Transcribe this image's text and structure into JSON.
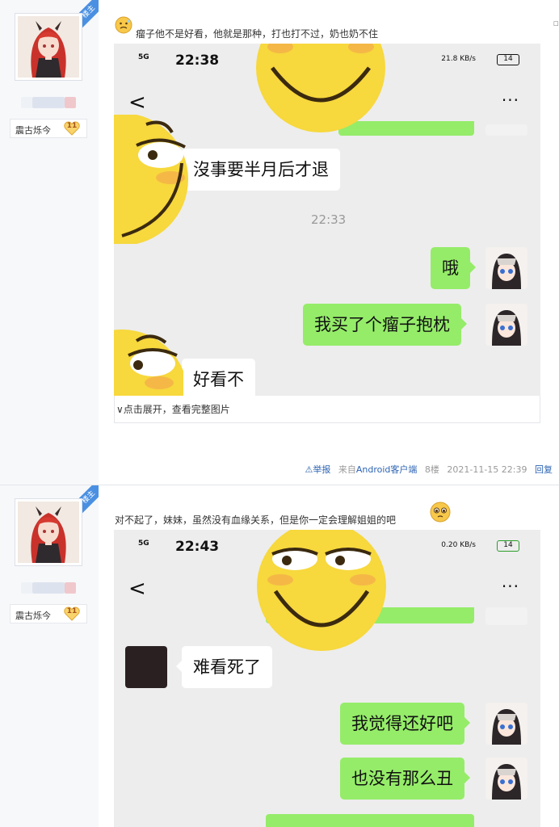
{
  "post1": {
    "corner_badge": "楼主",
    "level_name": "震古烁今",
    "level_num": "11",
    "text": "瘤子他不是好看，他就是那种，打也打不过，奶也奶不住",
    "shot": {
      "signal": "5G",
      "time": "22:38",
      "net_speed": "21.8 KB/s",
      "battery": "14",
      "back": "<",
      "more": "···",
      "bubble_other_1": "沒事要半月后才退",
      "timestamp": "22:33",
      "bubble_me_1": "哦",
      "bubble_me_2": "我买了个瘤子抱枕",
      "bubble_other_2": "好看不"
    },
    "expand_text": "点击展开，查看完整图片",
    "footer": {
      "report": "举报",
      "from_prefix": "来自",
      "client": "Android客户端",
      "floor": "8楼",
      "datetime": "2021-11-15 22:39",
      "reply": "回复"
    }
  },
  "post2": {
    "corner_badge": "楼主",
    "level_name": "震古烁今",
    "level_num": "11",
    "text": "对不起了，妹妹，虽然没有血缘关系，但是你一定会理解姐姐的吧",
    "shot": {
      "signal": "5G",
      "time": "22:43",
      "net_speed": "0.20 KB/s",
      "battery": "14",
      "back": "<",
      "more": "···",
      "bubble_other_1": "难看死了",
      "bubble_me_1": "我觉得还好吧",
      "bubble_me_2": "也没有那么丑"
    }
  },
  "colors": {
    "wechat_green": "#95ec69",
    "link_blue": "#2d64b3",
    "badge_blue": "#4a90e2",
    "emoji_yellow": "#f7d83d"
  }
}
